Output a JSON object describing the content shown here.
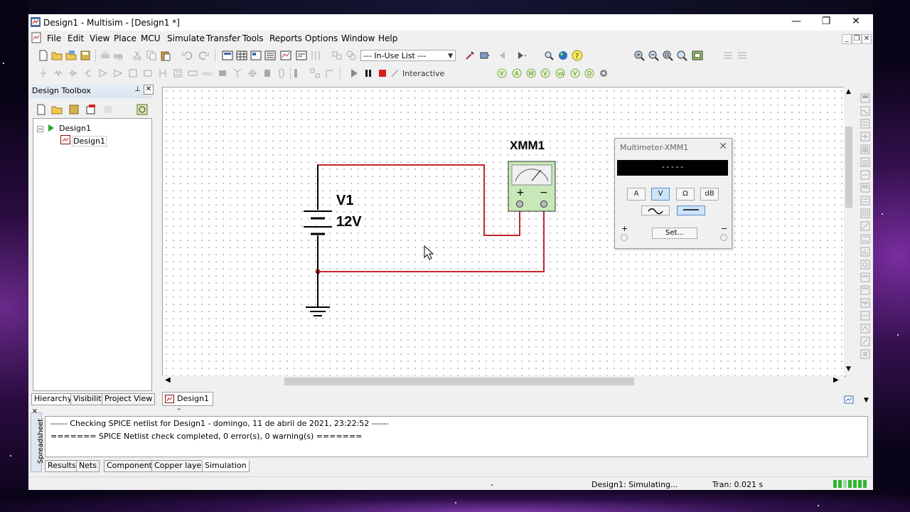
{
  "window": {
    "title": "Design1 - Multisim - [Design1 *]",
    "controls": {
      "minimize": "—",
      "restore": "❐",
      "close": "✕"
    }
  },
  "menu": [
    "File",
    "Edit",
    "View",
    "Place",
    "MCU",
    "Simulate",
    "Transfer",
    "Tools",
    "Reports",
    "Options",
    "Window",
    "Help"
  ],
  "toolbar": {
    "in_use_list": "--- In-Use List ---",
    "interactive_label": "Interactive"
  },
  "design_toolbox": {
    "title": "Design Toolbox",
    "tree_root": "Design1",
    "tree_child": "Design1",
    "tabs": [
      "Hierarchy",
      "Visibility",
      "Project View"
    ]
  },
  "schematic": {
    "source_name": "V1",
    "source_value": "12V",
    "meter_name": "XMM1",
    "meter_plus": "+",
    "meter_minus": "−",
    "sheet_tab": "Design1 *",
    "wire_color": "#c0272d"
  },
  "multimeter": {
    "title": "Multimeter-XMM1",
    "display": "-----",
    "modes": [
      "A",
      "V",
      "Ω",
      "dB"
    ],
    "active_mode": "V",
    "active_wave": "dc",
    "set_label": "Set...",
    "plus": "+",
    "minus": "−"
  },
  "spreadsheet": {
    "side_label": "Spreadsheet",
    "lines": [
      "------ Checking SPICE netlist for Design1 - domingo, 11 de abril de 2021, 23:22:52 ------",
      "======= SPICE Netlist check completed, 0 error(s), 0 warning(s) ======="
    ],
    "tabs": [
      "Results",
      "Nets",
      "Components",
      "Copper layers",
      "Simulation"
    ],
    "active_tab": "Simulation"
  },
  "status": {
    "dash": "-",
    "simulating": "Design1: Simulating...",
    "tran": "Tran: 0.021 s"
  }
}
